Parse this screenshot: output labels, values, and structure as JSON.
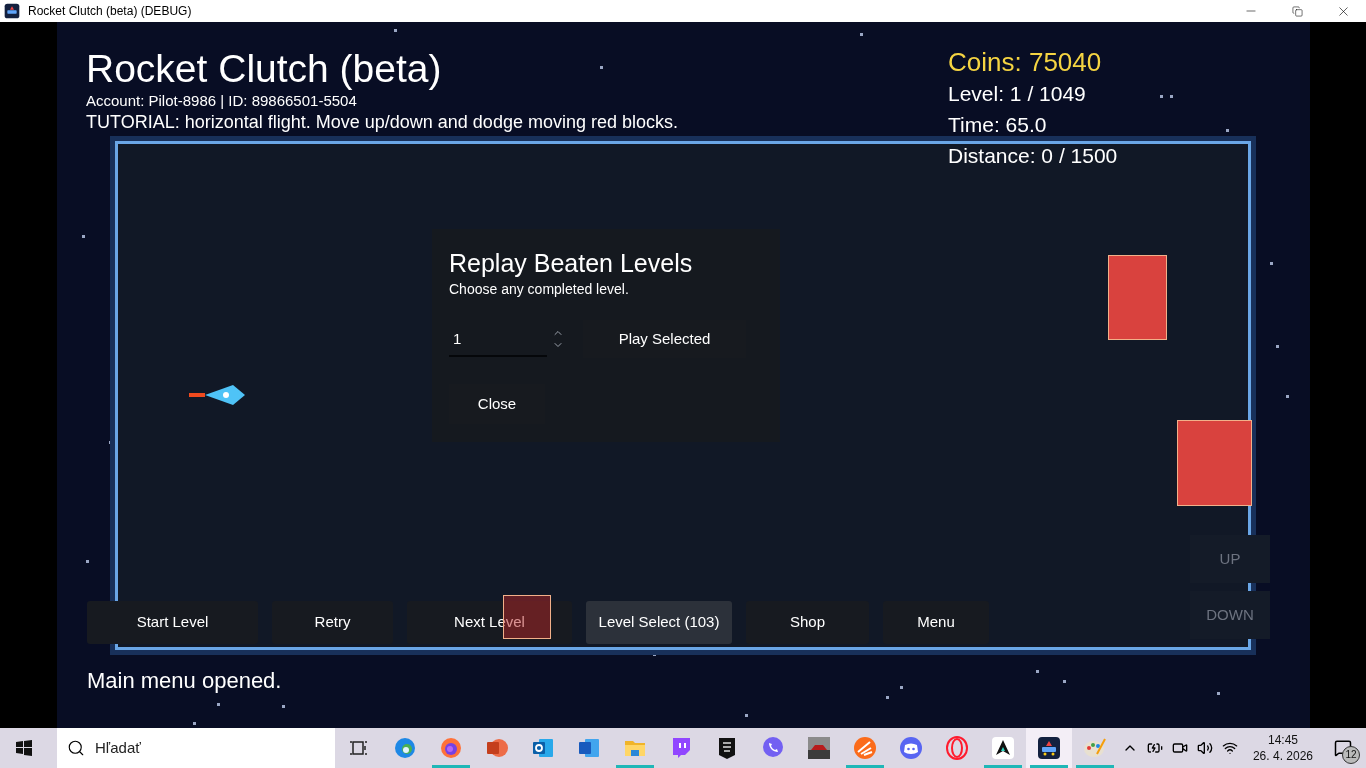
{
  "window": {
    "title": "Rocket Clutch (beta) (DEBUG)"
  },
  "hud": {
    "title": "Rocket Clutch (beta)",
    "account": "Account: Pilot-8986 | ID: 89866501-5504",
    "tutorial": "TUTORIAL: horizontal flight. Move up/down and dodge moving red blocks.",
    "coins": "Coins: 75040",
    "stats": [
      "Level: 1 / 1049",
      "Time: 65.0",
      "Distance: 0 / 1500"
    ]
  },
  "dialog": {
    "title": "Replay Beaten Levels",
    "subtitle": "Choose any completed level.",
    "level_value": "1",
    "play_button": "Play Selected",
    "close_button": "Close"
  },
  "menu_buttons": [
    {
      "label": "Start Level",
      "selected": false
    },
    {
      "label": "Retry",
      "selected": false
    },
    {
      "label": "Next Level",
      "selected": false
    },
    {
      "label": "Level Select (103)",
      "selected": true
    },
    {
      "label": "Shop",
      "selected": false
    },
    {
      "label": "Menu",
      "selected": false
    }
  ],
  "controls": [
    "UP",
    "DOWN"
  ],
  "status": "Main menu opened.",
  "taskbar": {
    "search_placeholder": "Hľadať",
    "apps": [
      {
        "kind": "taskview",
        "running": false,
        "selected": false
      },
      {
        "kind": "edge",
        "running": false,
        "selected": false
      },
      {
        "kind": "firefox",
        "running": true,
        "selected": false
      },
      {
        "kind": "powerpoint",
        "running": false,
        "selected": false
      },
      {
        "kind": "outlook",
        "running": false,
        "selected": false
      },
      {
        "kind": "word",
        "running": false,
        "selected": false
      },
      {
        "kind": "explorer",
        "running": true,
        "selected": false
      },
      {
        "kind": "twitch",
        "running": false,
        "selected": false
      },
      {
        "kind": "epic",
        "running": false,
        "selected": false
      },
      {
        "kind": "viber",
        "running": false,
        "selected": false
      },
      {
        "kind": "game",
        "running": false,
        "selected": false
      },
      {
        "kind": "orange",
        "running": true,
        "selected": false
      },
      {
        "kind": "discord",
        "running": false,
        "selected": false
      },
      {
        "kind": "opera",
        "running": false,
        "selected": false
      },
      {
        "kind": "arrow",
        "running": true,
        "selected": false
      },
      {
        "kind": "rocket",
        "running": true,
        "selected": true
      },
      {
        "kind": "paint",
        "running": true,
        "selected": false
      }
    ],
    "time": "14:45",
    "date": "26. 4. 2026",
    "notifications": "12"
  }
}
